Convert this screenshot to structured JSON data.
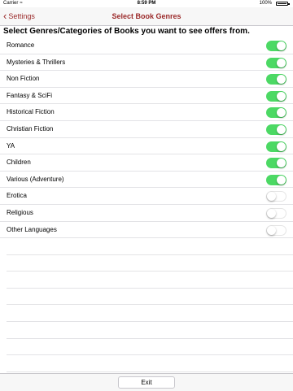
{
  "status_bar": {
    "carrier": "Carrier",
    "wifi_icon": "wifi-icon",
    "time": "8:59 PM",
    "battery": "100%"
  },
  "navbar": {
    "back_label": "Settings",
    "back_icon": "chevron-left-icon",
    "title": "Select Book Genres",
    "accent_color": "#9b2a2a"
  },
  "heading": "Select Genres/Categories of Books you want to see offers from.",
  "genres": [
    {
      "label": "Romance",
      "enabled": true
    },
    {
      "label": "Mysteries & Thrillers",
      "enabled": true
    },
    {
      "label": "Non Fiction",
      "enabled": true
    },
    {
      "label": "Fantasy & SciFi",
      "enabled": true
    },
    {
      "label": "Historical Fiction",
      "enabled": true
    },
    {
      "label": "Christian Fiction",
      "enabled": true
    },
    {
      "label": "YA",
      "enabled": true
    },
    {
      "label": "Children",
      "enabled": true
    },
    {
      "label": "Various (Adventure)",
      "enabled": true
    },
    {
      "label": "Erotica",
      "enabled": false
    },
    {
      "label": "Religious",
      "enabled": false
    },
    {
      "label": "Other Languages",
      "enabled": false
    }
  ],
  "toggle_on_color": "#4cd964",
  "footer": {
    "exit_label": "Exit"
  }
}
